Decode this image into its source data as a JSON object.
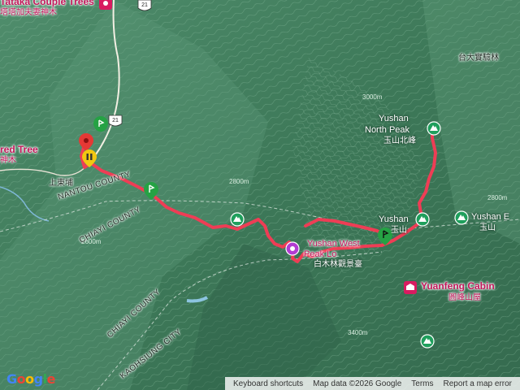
{
  "map": {
    "colors": {
      "route": "#ee3d55",
      "terrain_dark": "#3d7858",
      "terrain_light": "#6ea88a",
      "road": "#f5f1e8",
      "place_pink": "#d81b60",
      "marker_green": "#25a244",
      "marker_red": "#e53935",
      "marker_yellow": "#f2c811"
    },
    "places": {
      "tataka_couple_trees": "Tataka Couple Trees",
      "tataka_couple_trees_zh": "塔塔加夫妻神木",
      "sacred_tree": "red Tree",
      "sacred_tree_zh": "神木",
      "shangdongpu": "上東埔",
      "yushan_north_peak_1": "Yushan",
      "yushan_north_peak_2": "North Peak",
      "yushan_north_peak_zh": "玉山北峰",
      "taida_forest": "台大實驗林",
      "yushan": "Yushan",
      "yushan_zh": "玉山",
      "yushan_east": "Yushan E",
      "yushan_east_zh": "玉山",
      "yushan_west_1": "Yushan West",
      "yushan_west_2": "Peak Lo",
      "baimulin_zh": "白木林觀景臺",
      "yuanfeng_cabin": "Yuanfeng Cabin",
      "yuanfeng_cabin_zh": "圓峰山屋"
    },
    "boundaries": {
      "nantou_county": "NANTOU COUNTY",
      "chiayi_county_1": "CHIAYI COUNTY",
      "chiayi_county_2": "CHIAYI COUNTY",
      "kaohsiung_city": "KAOHSIUNG CITY"
    },
    "roads": {
      "route_21_a": "21",
      "route_21_b": "21"
    },
    "elevation_labels": [
      "2800m",
      "2600m",
      "3400m",
      "3000m",
      "2800m"
    ]
  },
  "footer": {
    "logo": "Google",
    "keyboard_shortcuts": "Keyboard shortcuts",
    "map_data": "Map data ©2026 Google",
    "terms": "Terms",
    "report": "Report a map error"
  }
}
